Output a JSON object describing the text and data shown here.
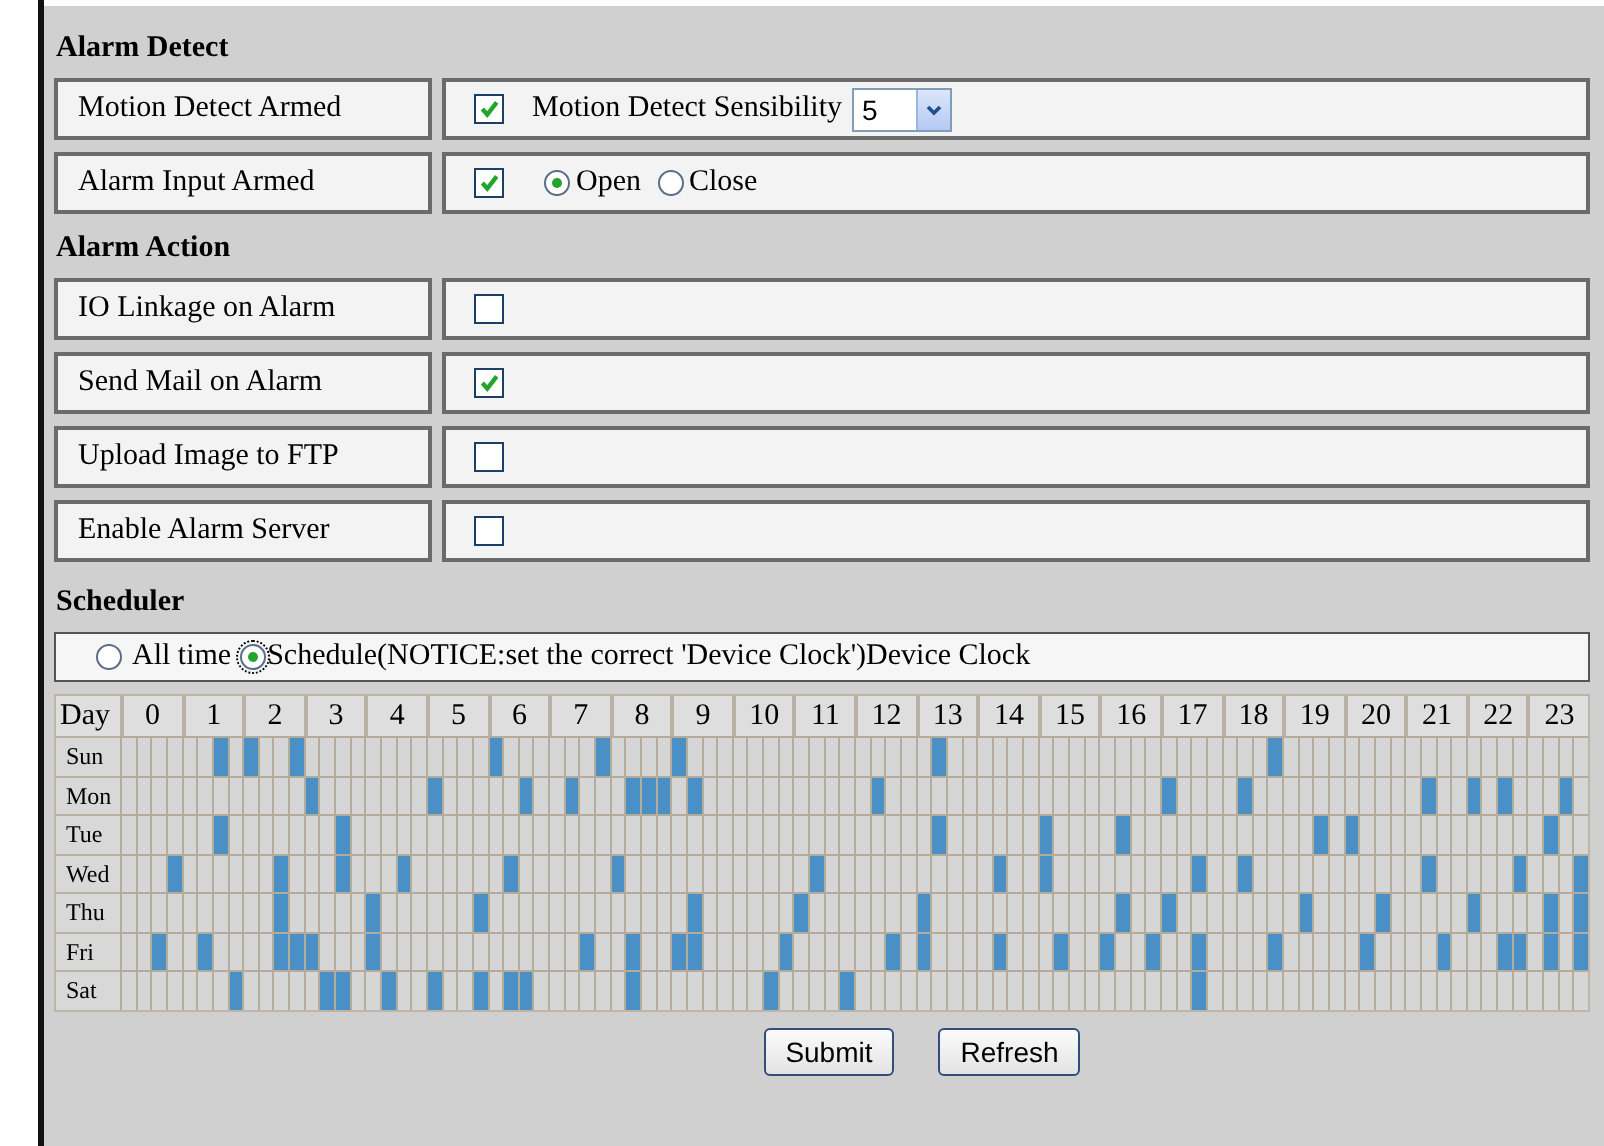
{
  "sections": [
    {
      "heading": "Alarm Detect",
      "rows": [
        {
          "label": "Motion Detect Armed",
          "checked": true,
          "extra": {
            "kind": "select",
            "label": "Motion Detect Sensibility",
            "value": "5"
          }
        },
        {
          "label": "Alarm Input Armed",
          "checked": true,
          "extra": {
            "kind": "radios",
            "options": [
              {
                "label": "Open",
                "selected": true
              },
              {
                "label": "Close",
                "selected": false
              }
            ]
          }
        }
      ]
    },
    {
      "heading": "Alarm Action",
      "rows": [
        {
          "label": "IO Linkage on Alarm",
          "checked": false
        },
        {
          "label": "Send Mail on Alarm",
          "checked": true
        },
        {
          "label": "Upload Image to FTP",
          "checked": false
        },
        {
          "label": "Enable Alarm Server",
          "checked": false
        }
      ]
    }
  ],
  "scheduler": {
    "heading": "Scheduler",
    "modes": [
      {
        "label": "All time",
        "selected": false
      },
      {
        "label": "Schedule(NOTICE:set the correct 'Device Clock')Device Clock",
        "selected": true
      }
    ],
    "grid": {
      "corner": "Day",
      "hours": [
        "0",
        "1",
        "2",
        "3",
        "4",
        "5",
        "6",
        "7",
        "8",
        "9",
        "10",
        "11",
        "12",
        "13",
        "14",
        "15",
        "16",
        "17",
        "18",
        "19",
        "20",
        "21",
        "22",
        "23"
      ],
      "days": [
        {
          "label": "Sun",
          "slots": [
            false,
            false,
            false,
            false,
            false,
            false,
            true,
            false,
            true,
            false,
            false,
            true,
            false,
            false,
            false,
            false,
            false,
            false,
            false,
            false,
            false,
            false,
            false,
            false,
            true,
            false,
            false,
            false,
            false,
            false,
            false,
            true,
            false,
            false,
            false,
            false,
            true,
            false,
            false,
            false,
            false,
            false,
            false,
            false,
            false,
            false,
            false,
            false,
            false,
            false,
            false,
            false,
            false,
            true,
            false,
            false,
            false,
            false,
            false,
            false,
            false,
            false,
            false,
            false,
            false,
            false,
            false,
            false,
            false,
            false,
            false,
            false,
            false,
            false,
            false,
            true,
            false,
            false,
            false,
            false,
            false,
            false,
            false,
            false,
            false,
            false,
            false,
            false,
            false,
            false,
            false,
            false,
            false,
            false,
            false,
            false
          ]
        },
        {
          "label": "Mon",
          "slots": [
            false,
            false,
            false,
            false,
            false,
            false,
            false,
            false,
            false,
            false,
            false,
            false,
            true,
            false,
            false,
            false,
            false,
            false,
            false,
            false,
            true,
            false,
            false,
            false,
            false,
            false,
            true,
            false,
            false,
            true,
            false,
            false,
            false,
            true,
            true,
            true,
            false,
            true,
            false,
            false,
            false,
            false,
            false,
            false,
            false,
            false,
            false,
            false,
            false,
            true,
            false,
            false,
            false,
            false,
            false,
            false,
            false,
            false,
            false,
            false,
            false,
            false,
            false,
            false,
            false,
            false,
            false,
            false,
            true,
            false,
            false,
            false,
            false,
            true,
            false,
            false,
            false,
            false,
            false,
            false,
            false,
            false,
            false,
            false,
            false,
            true,
            false,
            false,
            true,
            false,
            true,
            false,
            false,
            false,
            true,
            false
          ]
        },
        {
          "label": "Tue",
          "slots": [
            false,
            false,
            false,
            false,
            false,
            false,
            true,
            false,
            false,
            false,
            false,
            false,
            false,
            false,
            true,
            false,
            false,
            false,
            false,
            false,
            false,
            false,
            false,
            false,
            false,
            false,
            false,
            false,
            false,
            false,
            false,
            false,
            false,
            false,
            false,
            false,
            false,
            false,
            false,
            false,
            false,
            false,
            false,
            false,
            false,
            false,
            false,
            false,
            false,
            false,
            false,
            false,
            false,
            true,
            false,
            false,
            false,
            false,
            false,
            false,
            true,
            false,
            false,
            false,
            false,
            true,
            false,
            false,
            false,
            false,
            false,
            false,
            false,
            false,
            false,
            false,
            false,
            false,
            true,
            false,
            true,
            false,
            false,
            false,
            false,
            false,
            false,
            false,
            false,
            false,
            false,
            false,
            false,
            true,
            false,
            false
          ]
        },
        {
          "label": "Wed",
          "slots": [
            false,
            false,
            false,
            true,
            false,
            false,
            false,
            false,
            false,
            false,
            true,
            false,
            false,
            false,
            true,
            false,
            false,
            false,
            true,
            false,
            false,
            false,
            false,
            false,
            false,
            true,
            false,
            false,
            false,
            false,
            false,
            false,
            true,
            false,
            false,
            false,
            false,
            false,
            false,
            false,
            false,
            false,
            false,
            false,
            false,
            true,
            false,
            false,
            false,
            false,
            false,
            false,
            false,
            false,
            false,
            false,
            false,
            true,
            false,
            false,
            true,
            false,
            false,
            false,
            false,
            false,
            false,
            false,
            false,
            false,
            true,
            false,
            false,
            true,
            false,
            false,
            false,
            false,
            false,
            false,
            false,
            false,
            false,
            false,
            false,
            true,
            false,
            false,
            false,
            false,
            false,
            true,
            false,
            false,
            false,
            true
          ]
        },
        {
          "label": "Thu",
          "slots": [
            false,
            false,
            false,
            false,
            false,
            false,
            false,
            false,
            false,
            false,
            true,
            false,
            false,
            false,
            false,
            false,
            true,
            false,
            false,
            false,
            false,
            false,
            false,
            true,
            false,
            false,
            false,
            false,
            false,
            false,
            false,
            false,
            false,
            false,
            false,
            false,
            false,
            true,
            false,
            false,
            false,
            false,
            false,
            false,
            true,
            false,
            false,
            false,
            false,
            false,
            false,
            false,
            true,
            false,
            false,
            false,
            false,
            false,
            false,
            false,
            false,
            false,
            false,
            false,
            false,
            true,
            false,
            false,
            true,
            false,
            false,
            false,
            false,
            false,
            false,
            false,
            false,
            true,
            false,
            false,
            false,
            false,
            true,
            false,
            false,
            false,
            false,
            false,
            true,
            false,
            false,
            false,
            false,
            true,
            false,
            true
          ]
        },
        {
          "label": "Fri",
          "slots": [
            false,
            false,
            true,
            false,
            false,
            true,
            false,
            false,
            false,
            false,
            true,
            true,
            true,
            false,
            false,
            false,
            true,
            false,
            false,
            false,
            false,
            false,
            false,
            false,
            false,
            false,
            false,
            false,
            false,
            false,
            true,
            false,
            false,
            true,
            false,
            false,
            true,
            true,
            false,
            false,
            false,
            false,
            false,
            true,
            false,
            false,
            false,
            false,
            false,
            false,
            true,
            false,
            true,
            false,
            false,
            false,
            false,
            true,
            false,
            false,
            false,
            true,
            false,
            false,
            true,
            false,
            false,
            true,
            false,
            false,
            true,
            false,
            false,
            false,
            false,
            true,
            false,
            false,
            false,
            false,
            false,
            true,
            false,
            false,
            false,
            false,
            true,
            false,
            false,
            false,
            true,
            true,
            false,
            true,
            false,
            true
          ]
        },
        {
          "label": "Sat",
          "slots": [
            false,
            false,
            false,
            false,
            false,
            false,
            false,
            true,
            false,
            false,
            false,
            false,
            false,
            true,
            true,
            false,
            false,
            true,
            false,
            false,
            true,
            false,
            false,
            true,
            false,
            true,
            true,
            false,
            false,
            false,
            false,
            false,
            false,
            true,
            false,
            false,
            false,
            false,
            false,
            false,
            false,
            false,
            true,
            false,
            false,
            false,
            false,
            true,
            false,
            false,
            false,
            false,
            false,
            false,
            false,
            false,
            false,
            false,
            false,
            false,
            false,
            false,
            false,
            false,
            false,
            false,
            false,
            false,
            false,
            false,
            true,
            false,
            false,
            false,
            false,
            false,
            false,
            false,
            false,
            false,
            false,
            false,
            false,
            false,
            false,
            false,
            false,
            false,
            false,
            false,
            false,
            false,
            false,
            false,
            false,
            false
          ]
        }
      ]
    }
  },
  "buttons": [
    "Submit",
    "Refresh"
  ]
}
